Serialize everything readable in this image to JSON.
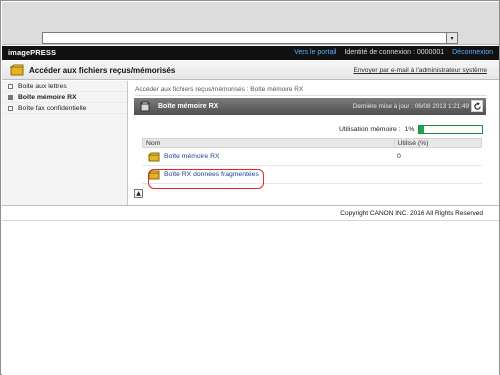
{
  "topbar": {
    "address_value": ""
  },
  "brandbar": {
    "brand": "imagePRESS",
    "portal_link": "Vers le portail",
    "login_text": "Identité de connexion : 0000001",
    "logout_link": "Déconnexion"
  },
  "header": {
    "title": "Accéder aux fichiers reçus/mémorisés",
    "email_link": "Envoyer par e-mail à l'administrateur système"
  },
  "sidebar": {
    "items": [
      {
        "label": "Boite aux lettres",
        "active": false
      },
      {
        "label": "Boîte mémoire RX",
        "active": true
      },
      {
        "label": "Boîte fax confidentielle",
        "active": false
      }
    ]
  },
  "main": {
    "breadcrumb": "Accéder aux fichiers reçus/mémorisés : Boîte mémoire RX",
    "panel_title": "Boîte mémoire RX",
    "updated": "Dernière mise à jour : 06/08 2013 1:21:49",
    "usage_label": "Utilisation mémoire :",
    "usage_percent": "1%",
    "usage_fraction": 0.08,
    "table_headers": [
      "Nom",
      "Utilisé (%)"
    ],
    "rows": [
      {
        "name": "Boîte mémoire RX",
        "used": "0"
      },
      {
        "name": "Boîte RX données fragmentées",
        "used": ""
      }
    ]
  },
  "footer": {
    "copyright": "Copyright CANON INC. 2016 All Rights Reserved"
  },
  "colors": {
    "brandbar_bg": "#111111",
    "link_blue": "#5ab0ff",
    "usage_green": "#19a64d",
    "highlight_red": "#e12727"
  }
}
